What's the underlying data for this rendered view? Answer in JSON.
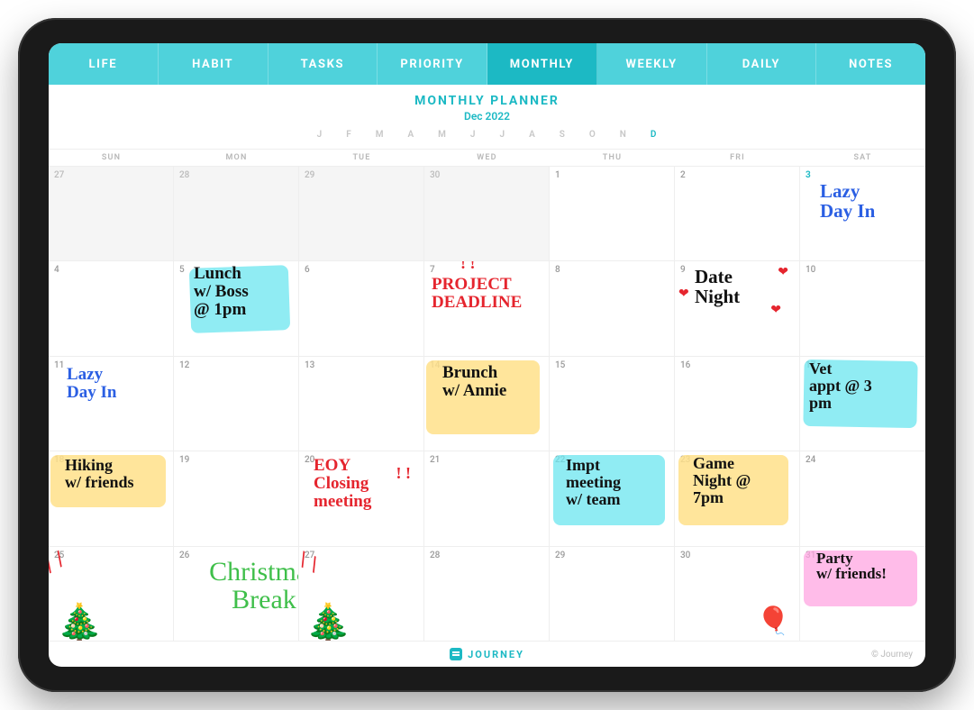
{
  "tabs": [
    {
      "label": "LIFE"
    },
    {
      "label": "HABIT"
    },
    {
      "label": "TASKS"
    },
    {
      "label": "PRIORITY"
    },
    {
      "label": "MONTHLY",
      "active": true
    },
    {
      "label": "WEEKLY"
    },
    {
      "label": "DAILY"
    },
    {
      "label": "NOTES"
    }
  ],
  "header": {
    "title": "MONTHLY PLANNER",
    "month_label": "Dec 2022"
  },
  "month_strip": [
    "J",
    "F",
    "M",
    "A",
    "M",
    "J",
    "J",
    "A",
    "S",
    "O",
    "N",
    "D"
  ],
  "month_strip_current_index": 11,
  "days_of_week": [
    "SUN",
    "MON",
    "TUE",
    "WED",
    "THU",
    "FRI",
    "SAT"
  ],
  "cells": [
    {
      "num": "27",
      "outside": true
    },
    {
      "num": "28",
      "outside": true
    },
    {
      "num": "29",
      "outside": true
    },
    {
      "num": "30",
      "outside": true
    },
    {
      "num": "1"
    },
    {
      "num": "2"
    },
    {
      "num": "3",
      "today": true
    },
    {
      "num": "4"
    },
    {
      "num": "5"
    },
    {
      "num": "6"
    },
    {
      "num": "7"
    },
    {
      "num": "8"
    },
    {
      "num": "9"
    },
    {
      "num": "10"
    },
    {
      "num": "11"
    },
    {
      "num": "12"
    },
    {
      "num": "13"
    },
    {
      "num": "14"
    },
    {
      "num": "15"
    },
    {
      "num": "16"
    },
    {
      "num": "17"
    },
    {
      "num": "18"
    },
    {
      "num": "19"
    },
    {
      "num": "20"
    },
    {
      "num": "21"
    },
    {
      "num": "22"
    },
    {
      "num": "23"
    },
    {
      "num": "24"
    },
    {
      "num": "25"
    },
    {
      "num": "26"
    },
    {
      "num": "27"
    },
    {
      "num": "28"
    },
    {
      "num": "29"
    },
    {
      "num": "30"
    },
    {
      "num": "31"
    }
  ],
  "notes": {
    "sat3": "Lazy\nDay In",
    "mon5": "Lunch\nw/ Boss\n@ 1pm",
    "wed7": "PROJECT\nDEADLINE",
    "fri9": "Date\nNight",
    "sun11": "Lazy\nDay In",
    "wed14": "Brunch\nw/ Annie",
    "sat17": "Vet\nappt @ 3\npm",
    "sun18": "Hiking\nw/ friends",
    "tue20": "EOY\nClosing\nmeeting",
    "thu22": "Impt\nmeeting\nw/ team",
    "fri23": "Game\nNight @\n7pm",
    "christmas": "Christmas\nBreak",
    "sat31": "Party\nw/ friends!"
  },
  "footer": {
    "brand": "JOURNEY",
    "credit": "© Journey"
  }
}
